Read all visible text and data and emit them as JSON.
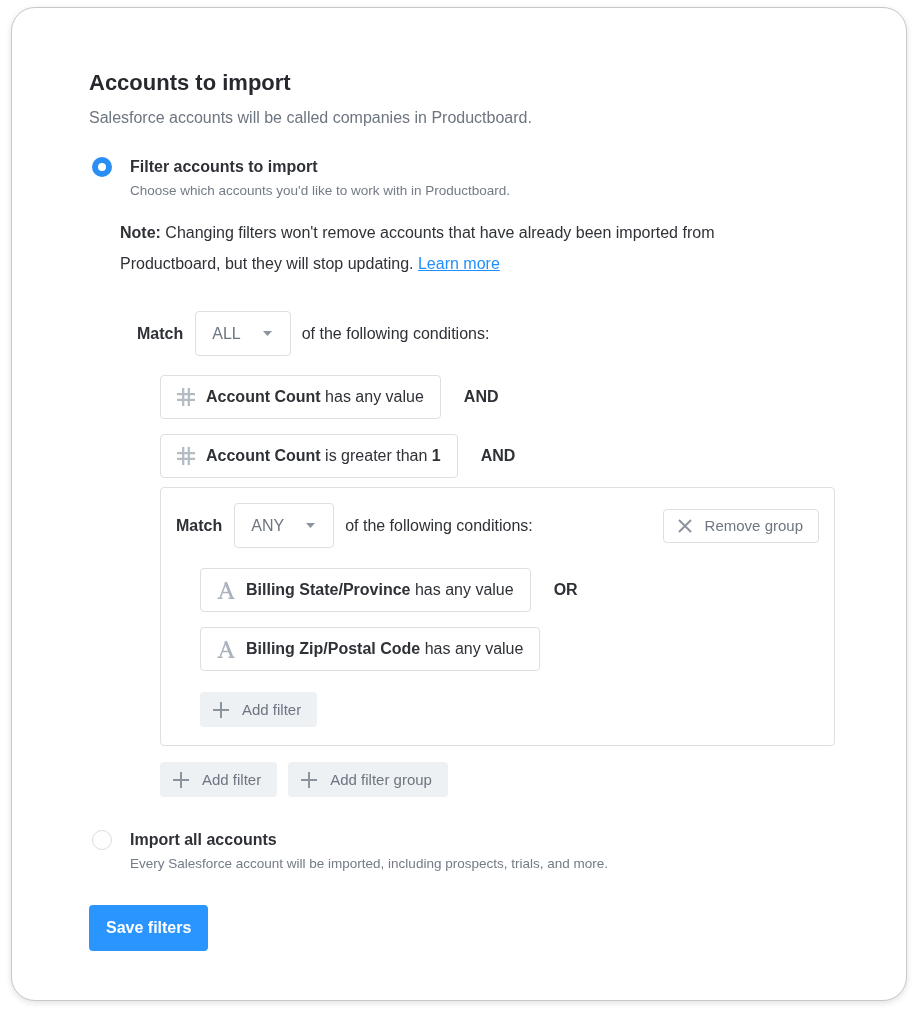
{
  "title": "Accounts to import",
  "subtitle": "Salesforce accounts will be called companies in Productboard.",
  "options": [
    {
      "label": "Filter accounts to import",
      "description": "Choose which accounts you'd like to work with in Productboard.",
      "selected": true,
      "note": "**Note:** Changing filters won't remove accounts that have already been imported from Productboard, but they will stop updating.",
      "note_link": "Learn more",
      "filter_group": {
        "match_label": "Match",
        "match_value": "ALL",
        "match_suffix": "of the following conditions:",
        "items": [
          {
            "kind": "number",
            "field": "Account Count",
            "operator": "has any value",
            "connector": "AND"
          },
          {
            "kind": "number",
            "field": "Account Count",
            "operator": "is greater than",
            "value": "1",
            "connector": "AND"
          },
          {
            "kind": "group",
            "match_label": "Match",
            "match_value": "ANY",
            "match_suffix": "of the following conditions:",
            "remove_button": "Remove group",
            "items": [
              {
                "kind": "text",
                "field": "Billing State/Province",
                "operator": "has any value",
                "connector": "OR"
              },
              {
                "kind": "text",
                "field": "Billing Zip/Postal Code",
                "operator": "has any value"
              }
            ],
            "add_buttons": [
              "Add filter"
            ]
          }
        ],
        "add_buttons": [
          "Add filter",
          "Add filter group"
        ]
      }
    },
    {
      "label": "Import all accounts",
      "description": "Every Salesforce account will be imported, including prospects, trials, and more.",
      "selected": false
    }
  ],
  "save_button": "Save filters"
}
